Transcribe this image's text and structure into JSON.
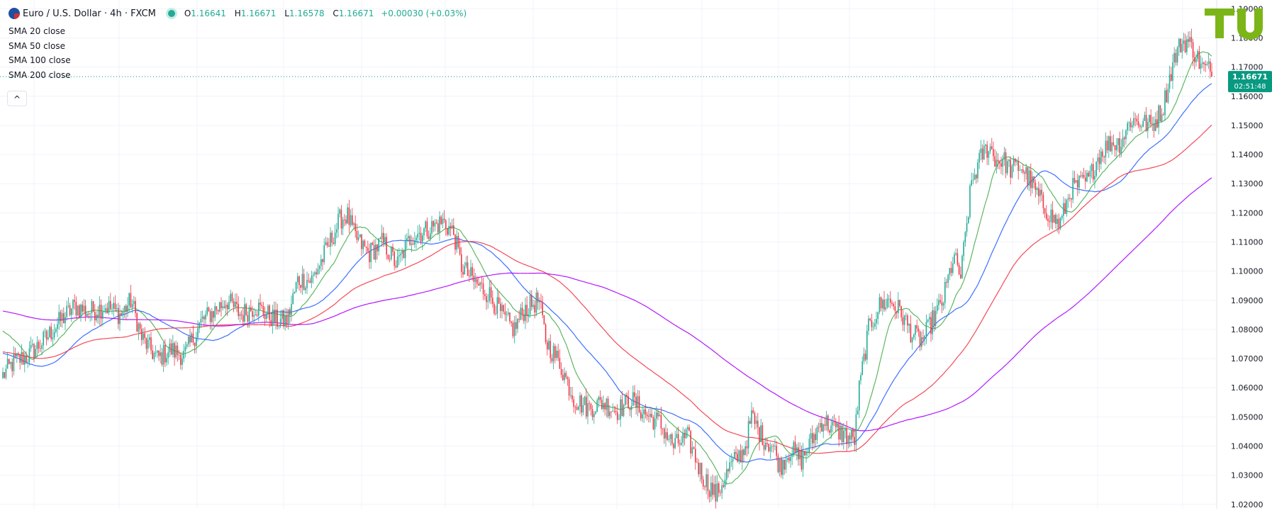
{
  "header": {
    "symbol": "Euro / U.S. Dollar · 4h · FXCM",
    "ohlc": [
      {
        "k": "O",
        "v": "1.16641"
      },
      {
        "k": "H",
        "v": "1.16671"
      },
      {
        "k": "L",
        "v": "1.16578"
      },
      {
        "k": "C",
        "v": "1.16671"
      }
    ],
    "change": "+0.00030 (+0.03%)"
  },
  "indicators": [
    "SMA 20 close",
    "SMA 50 close",
    "SMA 100 close",
    "SMA 200 close"
  ],
  "collapse_icon": "^",
  "price_label": {
    "value": "1.16671",
    "timer": "02:51:48"
  },
  "colors": {
    "up": "#22ab94",
    "down": "#f23645",
    "sma20": "#4caf50",
    "sma50": "#2962ff",
    "sma100": "#f23645",
    "sma200": "#aa00ff",
    "accent": "#089981",
    "logo": "#7cb518"
  },
  "logo_icon": "tu-logo-icon",
  "chart_data": {
    "type": "candlestick",
    "title": "Euro / U.S. Dollar · 4h · FXCM",
    "xlabel": "",
    "ylabel": "",
    "ylim": [
      1.0185,
      1.193
    ],
    "yticks": [
      "1.19000",
      "1.18000",
      "1.17000",
      "1.16000",
      "1.15000",
      "1.14000",
      "1.13000",
      "1.12000",
      "1.11000",
      "1.10000",
      "1.09000",
      "1.08000",
      "1.07000",
      "1.06000",
      "1.05000",
      "1.04000",
      "1.03000",
      "1.02000"
    ],
    "grid": true,
    "last_price": 1.16671,
    "price_path": [
      [
        0,
        1.063
      ],
      [
        20,
        1.069
      ],
      [
        40,
        1.071
      ],
      [
        65,
        1.077
      ],
      [
        85,
        1.083
      ],
      [
        105,
        1.088
      ],
      [
        125,
        1.086
      ],
      [
        150,
        1.088
      ],
      [
        170,
        1.085
      ],
      [
        185,
        1.09
      ],
      [
        200,
        1.077
      ],
      [
        222,
        1.07
      ],
      [
        240,
        1.073
      ],
      [
        260,
        1.071
      ],
      [
        285,
        1.083
      ],
      [
        320,
        1.09
      ],
      [
        340,
        1.085
      ],
      [
        360,
        1.088
      ],
      [
        390,
        1.083
      ],
      [
        405,
        1.083
      ],
      [
        420,
        1.097
      ],
      [
        440,
        1.097
      ],
      [
        460,
        1.107
      ],
      [
        480,
        1.118
      ],
      [
        490,
        1.119
      ],
      [
        500,
        1.112
      ],
      [
        520,
        1.106
      ],
      [
        540,
        1.11
      ],
      [
        560,
        1.102
      ],
      [
        580,
        1.112
      ],
      [
        600,
        1.114
      ],
      [
        625,
        1.117
      ],
      [
        640,
        1.113
      ],
      [
        650,
        1.102
      ],
      [
        670,
        1.096
      ],
      [
        690,
        1.092
      ],
      [
        710,
        1.084
      ],
      [
        725,
        1.08
      ],
      [
        740,
        1.087
      ],
      [
        760,
        1.09
      ],
      [
        770,
        1.076
      ],
      [
        790,
        1.068
      ],
      [
        810,
        1.056
      ],
      [
        830,
        1.053
      ],
      [
        850,
        1.055
      ],
      [
        870,
        1.052
      ],
      [
        890,
        1.056
      ],
      [
        910,
        1.051
      ],
      [
        930,
        1.048
      ],
      [
        950,
        1.04
      ],
      [
        970,
        1.043
      ],
      [
        990,
        1.03
      ],
      [
        1010,
        1.023
      ],
      [
        1030,
        1.033
      ],
      [
        1050,
        1.039
      ],
      [
        1060,
        1.05
      ],
      [
        1075,
        1.043
      ],
      [
        1090,
        1.04
      ],
      [
        1100,
        1.033
      ],
      [
        1115,
        1.039
      ],
      [
        1130,
        1.035
      ],
      [
        1145,
        1.042
      ],
      [
        1160,
        1.049
      ],
      [
        1175,
        1.046
      ],
      [
        1190,
        1.044
      ],
      [
        1205,
        1.042
      ],
      [
        1212,
        1.06
      ],
      [
        1225,
        1.08
      ],
      [
        1240,
        1.088
      ],
      [
        1255,
        1.09
      ],
      [
        1270,
        1.086
      ],
      [
        1285,
        1.079
      ],
      [
        1300,
        1.076
      ],
      [
        1315,
        1.083
      ],
      [
        1330,
        1.09
      ],
      [
        1345,
        1.105
      ],
      [
        1355,
        1.098
      ],
      [
        1370,
        1.13
      ],
      [
        1385,
        1.14
      ],
      [
        1395,
        1.143
      ],
      [
        1405,
        1.138
      ],
      [
        1415,
        1.138
      ],
      [
        1425,
        1.135
      ],
      [
        1440,
        1.136
      ],
      [
        1455,
        1.13
      ],
      [
        1470,
        1.123
      ],
      [
        1485,
        1.118
      ],
      [
        1495,
        1.116
      ],
      [
        1510,
        1.128
      ],
      [
        1525,
        1.13
      ],
      [
        1535,
        1.131
      ],
      [
        1550,
        1.14
      ],
      [
        1565,
        1.144
      ],
      [
        1580,
        1.144
      ],
      [
        1595,
        1.152
      ],
      [
        1610,
        1.151
      ],
      [
        1625,
        1.15
      ],
      [
        1640,
        1.156
      ],
      [
        1655,
        1.172
      ],
      [
        1665,
        1.178
      ],
      [
        1675,
        1.179
      ],
      [
        1685,
        1.175
      ],
      [
        1695,
        1.17
      ],
      [
        1705,
        1.169
      ],
      [
        1711,
        1.16671
      ]
    ],
    "series": [
      {
        "name": "SMA 20 close",
        "period": 20
      },
      {
        "name": "SMA 50 close",
        "period": 50
      },
      {
        "name": "SMA 100 close",
        "period": 100
      },
      {
        "name": "SMA 200 close",
        "period": 200
      }
    ]
  }
}
